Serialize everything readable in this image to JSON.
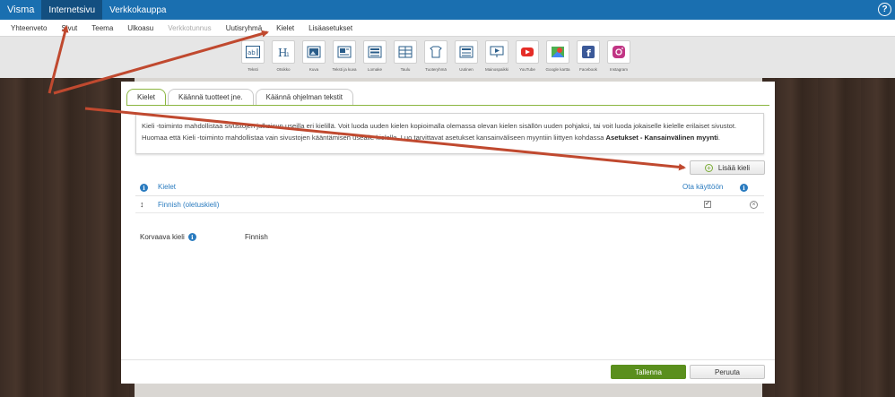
{
  "topbar": {
    "brand": "Visma",
    "tabs": [
      {
        "label": "Internetsivu",
        "active": true
      },
      {
        "label": "Verkkokauppa",
        "active": false
      }
    ],
    "help": "?"
  },
  "subnav": {
    "items": [
      {
        "label": "Yhteenveto"
      },
      {
        "label": "Sivut"
      },
      {
        "label": "Teema"
      },
      {
        "label": "Ulkoasu"
      },
      {
        "label": "Verkkotunnus",
        "disabled": true
      },
      {
        "label": "Uutisryhmä"
      },
      {
        "label": "Kielet"
      },
      {
        "label": "Lisäasetukset"
      }
    ]
  },
  "widgets": [
    {
      "label": "Teksti",
      "icon": "text-icon"
    },
    {
      "label": "Otsikko",
      "icon": "heading-icon"
    },
    {
      "label": "Kuva",
      "icon": "image-icon"
    },
    {
      "label": "Teksti ja kuva",
      "icon": "text-image-icon"
    },
    {
      "label": "Lomake",
      "icon": "form-icon"
    },
    {
      "label": "Taulu",
      "icon": "table-icon"
    },
    {
      "label": "Tuoteryhmä",
      "icon": "product-group-icon"
    },
    {
      "label": "Uutinen",
      "icon": "news-icon"
    },
    {
      "label": "Mainospaikki",
      "icon": "ad-icon"
    },
    {
      "label": "YouTube",
      "icon": "youtube-icon"
    },
    {
      "label": "Google kartta",
      "icon": "map-icon"
    },
    {
      "label": "Facebook",
      "icon": "facebook-icon"
    },
    {
      "label": "Instagram",
      "icon": "instagram-icon"
    }
  ],
  "modal": {
    "tabs": [
      {
        "label": "Kielet",
        "active": true
      },
      {
        "label": "Käännä tuotteet jne.",
        "active": false
      },
      {
        "label": "Käännä ohjelman tekstit",
        "active": false
      }
    ],
    "info_line1": "Kieli -toiminto mahdollistaa sivustojen julkaisun useilla eri kielillä. Voit luoda uuden kielen kopioimalla olemassa olevan kielen sisällön uuden pohjaksi, tai voit luoda jokaiselle kielelle erilaiset sivustot.",
    "info_line2_start": "Huomaa että Kieli -toiminto mahdollistaa vain sivustojen kääntämisen usealle kielelle. Luo tarvittavat asetukset kansainväliseen myyntiin liittyen kohdassa",
    "info_line2_bold": "Asetukset - Kansainvälinen myynti",
    "info_line2_end": ".",
    "add_language": "Lisää kieli",
    "table": {
      "col_language": "Kielet",
      "col_enable": "Ota käyttöön",
      "rows": [
        {
          "language": "Finnish (oletuskieli)",
          "enabled": true
        }
      ]
    },
    "fallback_label": "Korvaava kieli",
    "fallback_value": "Finnish",
    "save": "Tallenna",
    "cancel": "Peruuta"
  },
  "colors": {
    "topbar": "#1a6fb0",
    "accent_green": "#5a8f1d",
    "link_blue": "#2a7bbf",
    "arrow": "#c0492f"
  }
}
